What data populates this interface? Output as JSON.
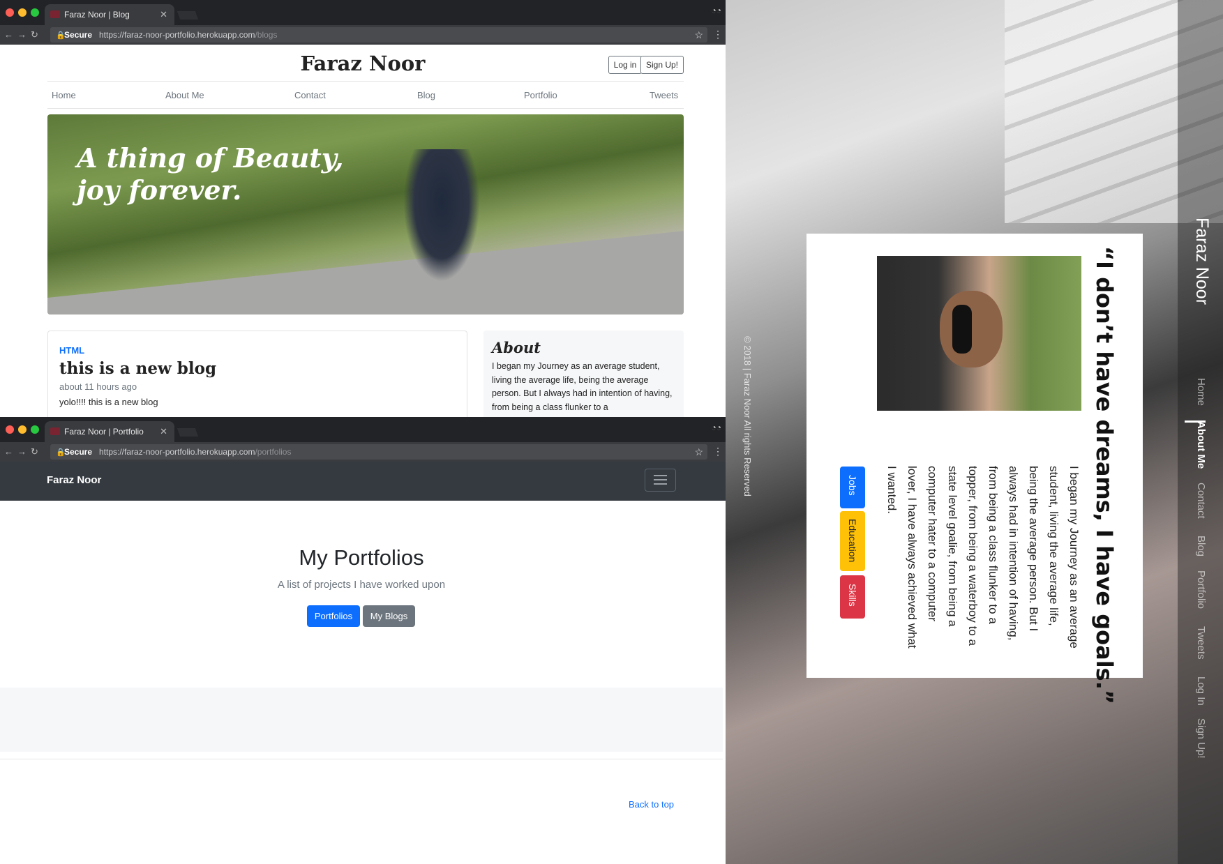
{
  "blog_window": {
    "tab_title": "Faraz Noor | Blog",
    "secure": "Secure",
    "url_base": "https://faraz-noor-portfolio.herokuapp.com",
    "url_path": "/blogs",
    "site_title": "Faraz Noor",
    "login": "Log in",
    "signup": "Sign Up!",
    "nav": [
      "Home",
      "About Me",
      "Contact",
      "Blog",
      "Portfolio",
      "Tweets"
    ],
    "hero_text": "A thing of Beauty, joy forever.",
    "post": {
      "category": "HTML",
      "title": "this is a new blog",
      "meta": "about 11 hours ago",
      "body": "yolo!!!! this is a new blog"
    },
    "about_heading": "About",
    "about_text": "I began my Journey as an average student, living the average life, being the average person. But I always had in intention of having, from being a class flunker to a"
  },
  "portfolio_window": {
    "tab_title": "Faraz Noor | Portfolio",
    "secure": "Secure",
    "url_base": "https://faraz-noor-portfolio.herokuapp.com",
    "url_path": "/portfolios",
    "brand": "Faraz Noor",
    "heading": "My Portfolios",
    "subheading": "A list of projects I have worked upon",
    "btn_portfolios": "Portfolios",
    "btn_blogs": "My Blogs",
    "back_to_top": "Back to top"
  },
  "about_page": {
    "name": "Faraz Noor",
    "nav": [
      "Home",
      "About Me",
      "Contact",
      "Blog",
      "Portfolio",
      "Tweets",
      "Log In",
      "Sign Up!"
    ],
    "active": "About Me",
    "copyright": "© 2018 | Faraz Noor All rights Reserved",
    "quote": "“I don’t have dreams, I have goals.”",
    "text_lines": [
      "I began my Journey as an average",
      "student, living the average life,",
      "being the average person. But I",
      "always had in intention of having,",
      "from being a class flunker to a",
      "topper, from being a waterboy to a",
      "state level goalie, from being a",
      "computer hater to a computer",
      "lover, I have always achieved what",
      "I wanted."
    ],
    "buttons": [
      "Jobs",
      "Education",
      "Skills"
    ]
  },
  "colors": {
    "primary": "#0d6efd",
    "secondary": "#6c757d",
    "warning": "#ffc107",
    "danger": "#dc3545",
    "navbar": "#343a40"
  }
}
